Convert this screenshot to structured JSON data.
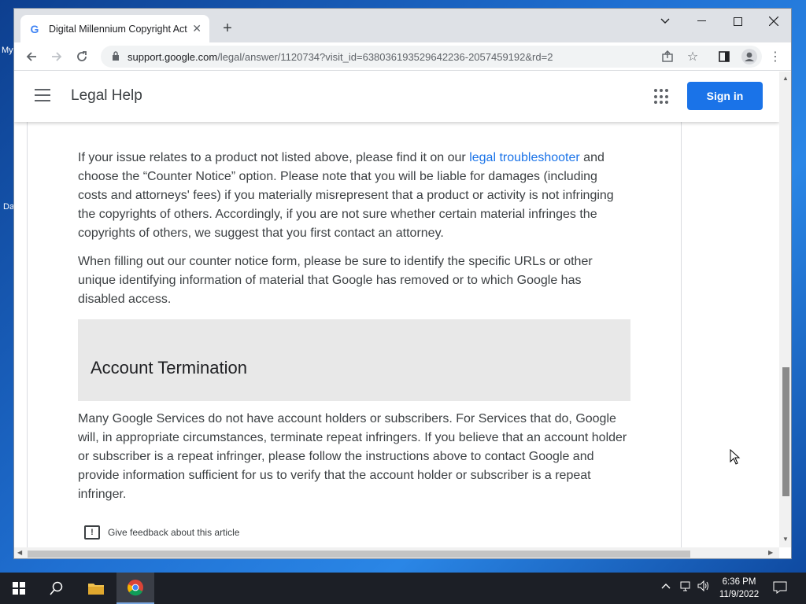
{
  "desktop": {
    "icon_label_1": "My",
    "icon_label_2": "Da"
  },
  "browser": {
    "tab_title": "Digital Millennium Copyright Act",
    "url_domain": "support.google.com",
    "url_path": "/legal/answer/1120734?visit_id=638036193529642236-2057459192&rd=2"
  },
  "header": {
    "title": "Legal Help",
    "sign_in_label": "Sign in"
  },
  "article": {
    "para1_pre": "If your issue relates to a product not listed above, please find it on our ",
    "para1_link": "legal troubleshooter",
    "para1_post": " and choose the “Counter Notice” option. Please note that you will be liable for damages (including costs and attorneys' fees) if you materially misrepresent that a product or activity is not infringing the copyrights of others. Accordingly, if you are not sure whether certain material infringes the copyrights of others, we suggest that you first contact an attorney.",
    "para2": "When filling out our counter notice form, please be sure to identify the specific URLs or other unique identifying information of material that Google has removed or to which Google has disabled access.",
    "section_heading": "Account Termination",
    "para3": "Many Google Services do not have account holders or subscribers. For Services that do, Google will, in appropriate circumstances, terminate repeat infringers. If you believe that an account holder or subscriber is a repeat infringer, please follow the instructions above to contact Google and provide information sufficient for us to verify that the account holder or subscriber is a repeat infringer.",
    "feedback_label": "Give feedback about this article"
  },
  "taskbar": {
    "time": "6:36 PM",
    "date": "11/9/2022"
  },
  "icons": [
    "google-favicon",
    "close-icon",
    "plus-icon",
    "chevron-down-icon",
    "minimize-icon",
    "maximize-icon",
    "close-window-icon",
    "back-icon",
    "forward-icon",
    "reload-icon",
    "lock-icon",
    "share-icon",
    "star-icon",
    "sidepanel-icon",
    "profile-icon",
    "kebab-menu-icon",
    "hamburger-icon",
    "apps-grid-icon",
    "feedback-icon",
    "windows-start-icon",
    "search-icon",
    "file-explorer-icon",
    "chrome-icon",
    "chevron-up-icon",
    "network-icon",
    "volume-icon",
    "notification-icon"
  ]
}
